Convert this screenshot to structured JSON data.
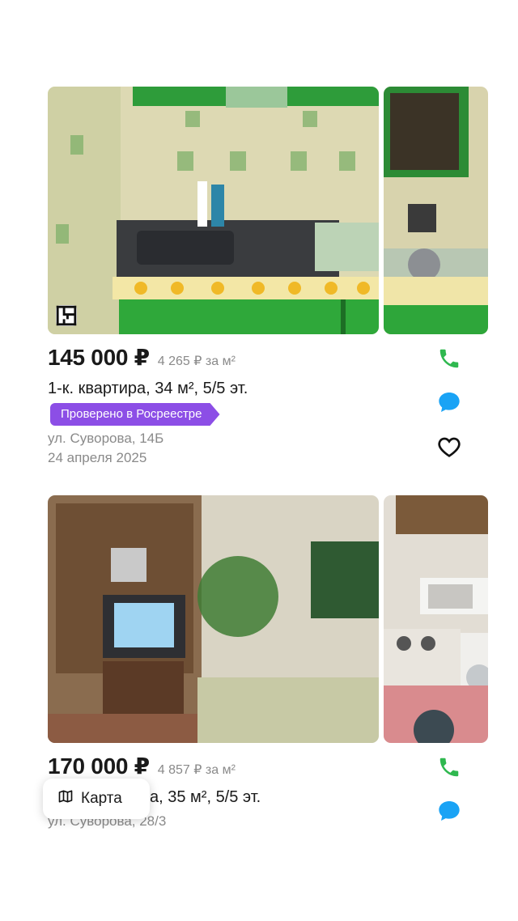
{
  "listings": [
    {
      "price": "145 000 ₽",
      "price_per_m2": "4 265 ₽ за м²",
      "title": "1-к. квартира, 34 м², 5/5 эт.",
      "badge": "Проверено в Росреестре",
      "address": "ул. Суворова, 14Б",
      "date": "24 апреля 2025",
      "icons": [
        "floor-plan-icon",
        "phone-icon",
        "chat-icon",
        "heart-icon"
      ]
    },
    {
      "price": "170 000 ₽",
      "price_per_m2": "4 857 ₽ за м²",
      "title_visible": "а, 35 м², 5/5 эт.",
      "address": "ул. Суворова, 28/3",
      "icons": [
        "phone-icon",
        "chat-icon"
      ]
    }
  ],
  "map_button": {
    "label": "Карта",
    "icon": "map-icon"
  },
  "colors": {
    "accent_green": "#2fb84f",
    "chat_blue": "#1aa3f5",
    "badge_purple": "#8c4ee6",
    "muted": "#8a8a8a"
  }
}
